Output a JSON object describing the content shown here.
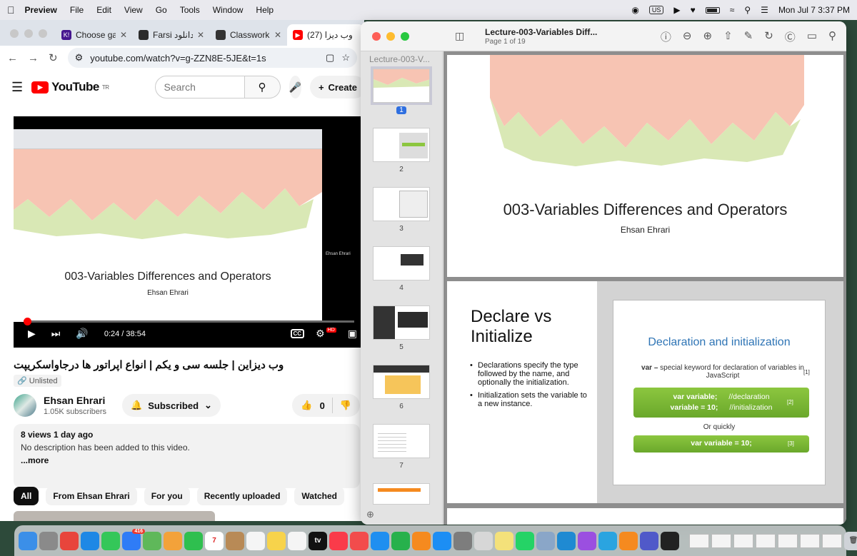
{
  "menubar": {
    "app_name": "Preview",
    "menus": [
      "File",
      "Edit",
      "View",
      "Go",
      "Tools",
      "Window",
      "Help"
    ],
    "input_source": "US",
    "datetime": "Mon Jul 7  3:37 PM"
  },
  "chrome": {
    "tabs": [
      {
        "label": "Choose gam",
        "icon_text": "K!",
        "icon_color": "#46178f"
      },
      {
        "label": "Farsi دانلود +",
        "icon_text": "",
        "icon_color": "#2b2b2b"
      },
      {
        "label": "Classwork fo",
        "icon_text": "",
        "icon_color": "#333333"
      },
      {
        "label": "(27) وب دیزا",
        "icon_text": "▶",
        "icon_color": "#ff0000"
      }
    ],
    "url": "youtube.com/watch?v=g-ZZN8E-5JE&t=1s"
  },
  "youtube": {
    "logo_text": "YouTube",
    "region": "TR",
    "search_placeholder": "Search",
    "create_label": "Create",
    "player": {
      "slide_title": "003-Variables Differences and Operators",
      "slide_author": "Ehsan Ehrari",
      "side_name": "Ehsan Ehrari",
      "time": "0:24 / 38:54",
      "hd_badge": "HD",
      "progress_fraction": 0.0103
    },
    "video_title": "وب دیزاین | جلسه سی و یکم | انواع اپراتور ها درجاواسکریپت",
    "visibility": "Unlisted",
    "channel_name": "Ehsan Ehrari",
    "subscribers": "1.05K subscribers",
    "subscribed_label": "Subscribed",
    "likes": "0",
    "description": {
      "meta": "8 views  1 day ago",
      "text": "No description has been added to this video.",
      "more": "...more"
    },
    "chips": [
      "All",
      "From Ehsan Ehrari",
      "For you",
      "Recently uploaded",
      "Watched"
    ]
  },
  "preview": {
    "doc_title": "Lecture-003-Variables Diff...",
    "page_info": "Page 1 of 19",
    "sidebar_title": "Lecture-003-V...",
    "thumbnails": [
      "1",
      "2",
      "3",
      "4",
      "5",
      "6",
      "7"
    ],
    "page1": {
      "title": "003-Variables Differences and Operators",
      "author": "Ehsan Ehrari"
    },
    "page2": {
      "heading_line1": "Declare vs",
      "heading_line2": "Initialize",
      "bullets": [
        "Declarations specify the type followed by the name, and optionally the initialization.",
        "Initialization sets the variable to a new instance."
      ],
      "slide_title": "Declaration and initialization",
      "var_keyword": "var –",
      "var_desc": "special keyword for declaration of variables in JavaScript",
      "ref1": "[1]",
      "code1_a": "var variable;",
      "code1_a_comment": "//declaration",
      "code1_b": "variable = 10;",
      "code1_b_comment": "//initialization",
      "ref2": "[2]",
      "or_text": "Or quickly",
      "code2": "var variable = 10;",
      "ref3": "[3]"
    }
  },
  "dock": {
    "apps": [
      {
        "name": "finder",
        "color": "#3b8fe8"
      },
      {
        "name": "launchpad",
        "color": "#8a8a8a"
      },
      {
        "name": "chrome",
        "color": "#e8453c"
      },
      {
        "name": "safari",
        "color": "#1e88e5"
      },
      {
        "name": "messages",
        "color": "#34c759"
      },
      {
        "name": "mail",
        "color": "#2f7cf6",
        "badge": "416"
      },
      {
        "name": "maps",
        "color": "#5fb85a"
      },
      {
        "name": "photos",
        "color": "#f3a23a"
      },
      {
        "name": "facetime",
        "color": "#2fbf4f"
      },
      {
        "name": "calendar",
        "color": "#ffffff",
        "label": "7",
        "text_color": "#d22"
      },
      {
        "name": "contacts",
        "color": "#b88a56"
      },
      {
        "name": "reminders",
        "color": "#f5f5f5"
      },
      {
        "name": "notes",
        "color": "#f7d34b"
      },
      {
        "name": "freeform",
        "color": "#f5f5f5"
      },
      {
        "name": "tv",
        "color": "#111111",
        "label": "tv"
      },
      {
        "name": "music",
        "color": "#fa3b4a"
      },
      {
        "name": "news",
        "color": "#f24c4c"
      },
      {
        "name": "keynote",
        "color": "#1f8ff0"
      },
      {
        "name": "numbers",
        "color": "#27b14c"
      },
      {
        "name": "pages",
        "color": "#f58a1f"
      },
      {
        "name": "app-store",
        "color": "#1c8ef4"
      },
      {
        "name": "system-settings",
        "color": "#7d7d7d"
      },
      {
        "name": "preview",
        "color": "#d7d7d7"
      },
      {
        "name": "stickies",
        "color": "#f4e17a"
      },
      {
        "name": "whatsapp",
        "color": "#25d366"
      },
      {
        "name": "image-capture",
        "color": "#8aa6c8"
      },
      {
        "name": "vscode",
        "color": "#1f8ad2"
      },
      {
        "name": "podcasts",
        "color": "#9b4fe0"
      },
      {
        "name": "telegram",
        "color": "#2aa4e0"
      },
      {
        "name": "books",
        "color": "#f58a1f"
      },
      {
        "name": "teams",
        "color": "#5059c9"
      },
      {
        "name": "chatgpt",
        "color": "#222222"
      }
    ]
  }
}
